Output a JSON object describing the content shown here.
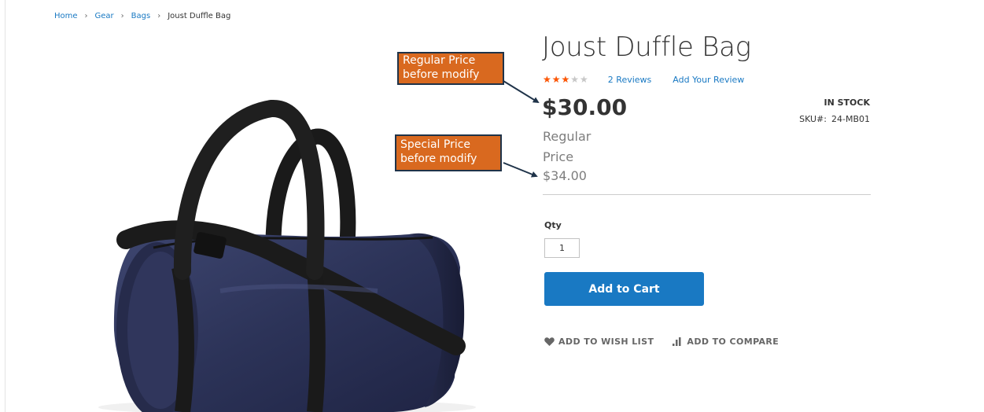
{
  "breadcrumb": {
    "items": [
      "Home",
      "Gear",
      "Bags"
    ],
    "current": "Joust Duffle Bag"
  },
  "product": {
    "name": "Joust Duffle Bag",
    "rating_percent": 60,
    "reviews_link": "2  Reviews",
    "add_review_link": "Add Your Review",
    "price": "$30.00",
    "old_price_label": "Regular Price",
    "old_price": "$34.00",
    "stock_status": "IN STOCK",
    "sku_label": "SKU#:",
    "sku": "24-MB01"
  },
  "cart": {
    "qty_label": "Qty",
    "qty_value": "1",
    "add_to_cart": "Add to Cart"
  },
  "actions": {
    "wishlist": "ADD TO WISH LIST",
    "compare": "ADD TO COMPARE"
  },
  "annotations": {
    "regular_line1": "Regular Price",
    "regular_line2": "before modify",
    "special_line1": "Special Price",
    "special_line2": "before modify"
  },
  "colors": {
    "link": "#1979c3",
    "button": "#1979c3",
    "star": "#ff5501",
    "callout_bg": "#d9691f",
    "callout_border": "#1f3349"
  },
  "icons": {
    "star": "star-icon",
    "wishlist": "heart-icon",
    "compare": "compare-bars-icon",
    "arrow": "arrow-icon"
  }
}
